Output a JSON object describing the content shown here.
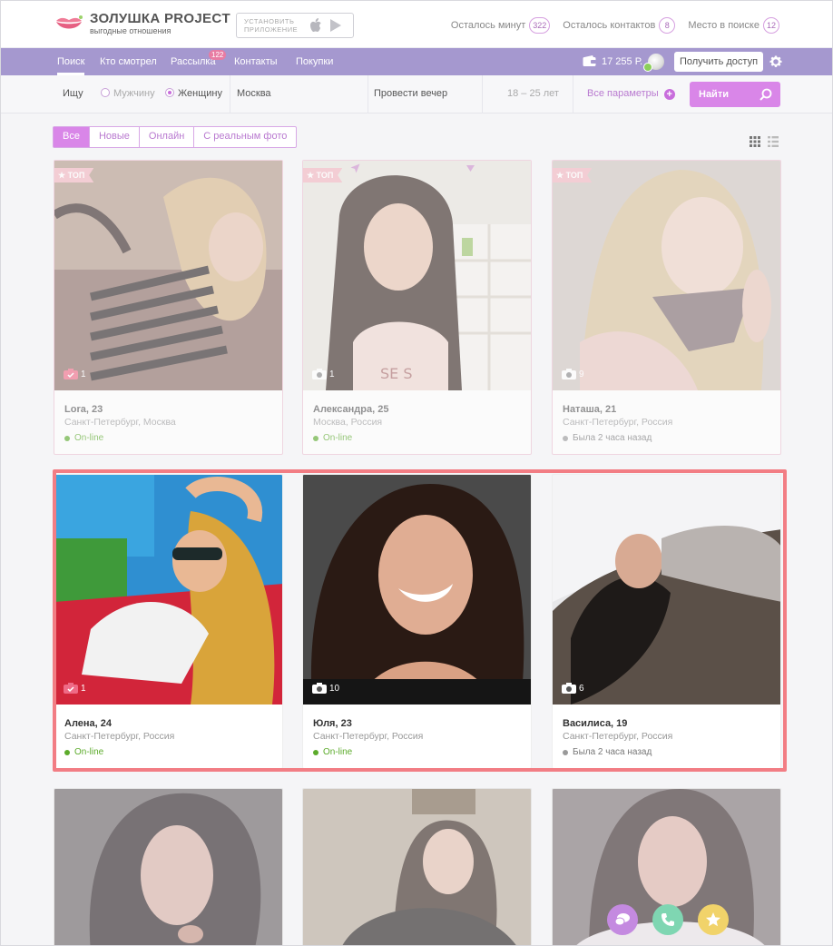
{
  "logo": {
    "title": "ЗОЛУШКА PROJECT",
    "subtitle": "выгодные отношения"
  },
  "store": {
    "text_line1": "УСТАНОВИТЬ",
    "text_line2": "ПРИЛОЖЕНИЕ",
    "icons": [
      "apple-icon",
      "play-store-icon"
    ]
  },
  "stats": [
    {
      "label": "Осталось минут",
      "value": "322"
    },
    {
      "label": "Осталось контактов",
      "value": "8"
    },
    {
      "label": "Место в поиске",
      "value": "12"
    }
  ],
  "nav": {
    "items": [
      "Поиск",
      "Кто смотрел",
      "Рассылка",
      "Контакты",
      "Покупки"
    ],
    "active": "Поиск",
    "mailing_badge": "122",
    "balance": "17 255 Р.",
    "access_button": "Получить доступ"
  },
  "search": {
    "looking_label": "Ищу",
    "option_men": "Мужчину",
    "option_women": "Женщину",
    "selected": "Женщину",
    "city": "Москва",
    "purpose": "Провести вечер",
    "age_range": "18  –  25 лет",
    "all_params": "Все параметры",
    "find_button": "Найти"
  },
  "filters": {
    "items": [
      "Все",
      "Новые",
      "Онлайн",
      "С реальным фото"
    ],
    "active": "Все"
  },
  "top_badge_label": "ТОП",
  "cards": [
    {
      "name": "Lora, 23",
      "city": "Санкт-Петербург, Москва",
      "status": "On-line",
      "online": true,
      "photos": "1",
      "verified": true,
      "top": true
    },
    {
      "name": "Александра, 25",
      "city": "Москва, Россия",
      "status": "On-line",
      "online": true,
      "photos": "1",
      "verified": false,
      "top": true
    },
    {
      "name": "Наташа, 21",
      "city": "Санкт-Петербург, Россия",
      "status": "Была 2 часа назад",
      "online": false,
      "photos": "9",
      "verified": false,
      "top": true
    },
    {
      "name": "Алена, 24",
      "city": "Санкт-Петербург, Россия",
      "status": "On-line",
      "online": true,
      "photos": "1",
      "verified": true,
      "top": false
    },
    {
      "name": "Юля, 23",
      "city": "Санкт-Петербург, Россия",
      "status": "On-line",
      "online": true,
      "photos": "10",
      "verified": false,
      "top": false
    },
    {
      "name": "Василиса, 19",
      "city": "Санкт-Петербург, Россия",
      "status": "Была 2 часа назад",
      "online": false,
      "photos": "6",
      "verified": false,
      "top": false
    }
  ],
  "colors": {
    "accent": "#d986e8",
    "nav_bg": "#a598cf",
    "online": "#5cab2b",
    "highlight": "#f27d84"
  }
}
